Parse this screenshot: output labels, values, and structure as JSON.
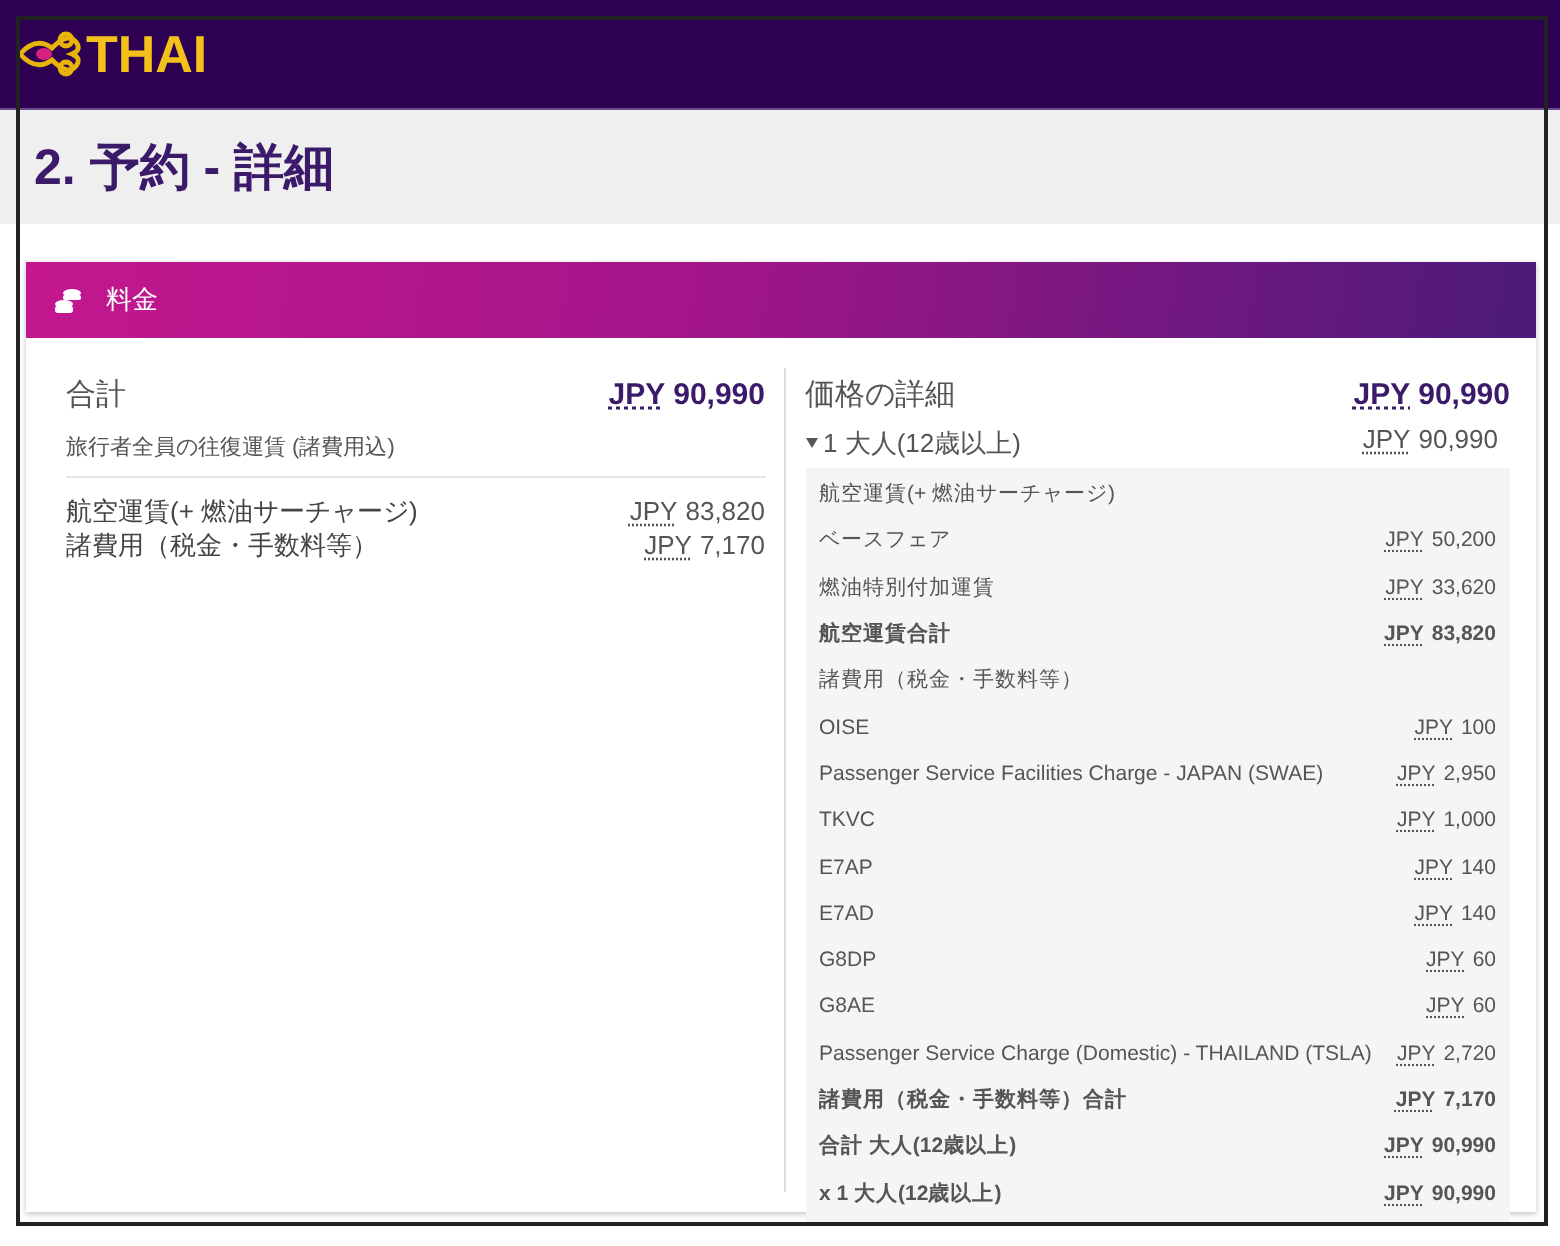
{
  "logo": {
    "text": "THAI"
  },
  "page_title": "2. 予約 - 詳細",
  "section": {
    "title": "料金"
  },
  "summary": {
    "label": "合計",
    "currency": "JPY",
    "amount": "90,990",
    "note": "旅行者全員の往復運賃 (諸費用込)",
    "items": [
      {
        "label": "航空運賃(+ 燃油サーチャージ)",
        "currency": "JPY",
        "amount": "83,820"
      },
      {
        "label": "諸費用（税金・手数料等）",
        "currency": "JPY",
        "amount": "7,170"
      }
    ]
  },
  "details": {
    "label": "価格の詳細",
    "currency": "JPY",
    "amount": "90,990",
    "passenger": {
      "label": "1 大人(12歳以上)",
      "expanded": true,
      "currency": "JPY",
      "amount": "90,990",
      "rows": [
        {
          "kind": "heading",
          "label": "航空運賃(+ 燃油サーチャージ)"
        },
        {
          "kind": "item",
          "label": "ベースフェア",
          "currency": "JPY",
          "amount": "50,200"
        },
        {
          "kind": "item",
          "label": "燃油特別付加運賃",
          "currency": "JPY",
          "amount": "33,620"
        },
        {
          "kind": "total",
          "label": "航空運賃合計",
          "currency": "JPY",
          "amount": "83,820"
        },
        {
          "kind": "heading",
          "label": "諸費用（税金・手数料等）"
        },
        {
          "kind": "item",
          "label": "OISE",
          "currency": "JPY",
          "amount": "100"
        },
        {
          "kind": "item",
          "label": "Passenger Service Facilities Charge - JAPAN (SWAE)",
          "currency": "JPY",
          "amount": "2,950"
        },
        {
          "kind": "item",
          "label": "TKVC",
          "currency": "JPY",
          "amount": "1,000"
        },
        {
          "kind": "item",
          "label": "E7AP",
          "currency": "JPY",
          "amount": "140"
        },
        {
          "kind": "item",
          "label": "E7AD",
          "currency": "JPY",
          "amount": "140"
        },
        {
          "kind": "item",
          "label": "G8DP",
          "currency": "JPY",
          "amount": "60"
        },
        {
          "kind": "item",
          "label": "G8AE",
          "currency": "JPY",
          "amount": "60"
        },
        {
          "kind": "item",
          "label": "Passenger Service Charge (Domestic) - THAILAND (TSLA)",
          "currency": "JPY",
          "amount": "2,720"
        },
        {
          "kind": "total",
          "label": "諸費用（税金・手数料等）合計",
          "currency": "JPY",
          "amount": "7,170"
        },
        {
          "kind": "total",
          "label": "合計 大人(12歳以上)",
          "currency": "JPY",
          "amount": "90,990"
        },
        {
          "kind": "total",
          "label": "x 1 大人(12歳以上)",
          "currency": "JPY",
          "amount": "90,990"
        }
      ]
    }
  }
}
